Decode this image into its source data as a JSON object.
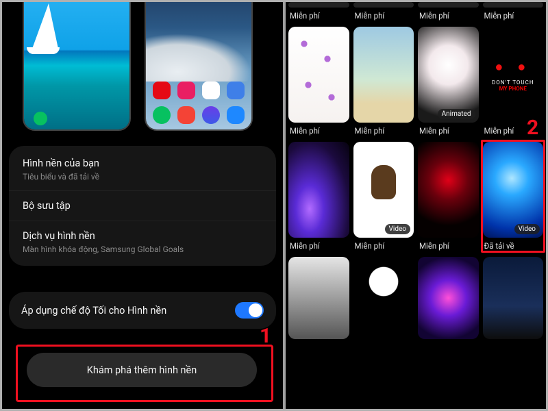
{
  "left": {
    "menu": {
      "yourWallpapers": {
        "title": "Hình nền của bạn",
        "sub": "Tiêu biểu và đã tải về"
      },
      "gallery": {
        "title": "Bộ sưu tập"
      },
      "services": {
        "title": "Dịch vụ hình nền",
        "sub": "Màn hình khóa động, Samsung Global Goals"
      }
    },
    "darkMode": {
      "label": "Áp dụng chế độ Tối cho Hình nền",
      "on": true
    },
    "exploreButton": "Khám phá thêm hình nền",
    "marker1": "1"
  },
  "right": {
    "labels": {
      "free": "Miễn phí",
      "downloaded": "Đã tải về",
      "animated": "Animated",
      "video": "Video"
    },
    "marker2": "2",
    "row0": [
      {
        "cap": "free"
      },
      {
        "cap": "free"
      },
      {
        "cap": "free"
      },
      {
        "cap": "free"
      }
    ],
    "row1": [
      {
        "art": "butterfly",
        "cap": "free"
      },
      {
        "art": "beach",
        "cap": "free"
      },
      {
        "art": "blossom",
        "cap": "free",
        "badge": "animated"
      },
      {
        "art": "dont",
        "cap": "free"
      }
    ],
    "row2": [
      {
        "art": "galaxy",
        "cap": "free"
      },
      {
        "art": "cat",
        "cap": "free",
        "badge": "video"
      },
      {
        "art": "rose",
        "cap": "free"
      },
      {
        "art": "jelly",
        "cap": "downloaded",
        "badge": "video",
        "highlight": true
      }
    ],
    "row3": [
      {
        "art": "street"
      },
      {
        "art": "wolf"
      },
      {
        "art": "nebula"
      },
      {
        "art": "sky"
      }
    ]
  }
}
